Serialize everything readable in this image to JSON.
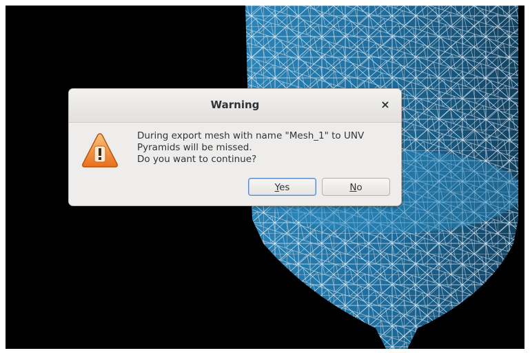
{
  "dialog": {
    "title": "Warning",
    "close_glyph": "×",
    "icon": "warning-triangle-icon",
    "message_lines": [
      "During export mesh with name \"Mesh_1\" to UNV",
      "Pyramids will be missed.",
      "Do you want to continue?"
    ],
    "buttons": {
      "yes_mnemonic": "Y",
      "yes_rest": "es",
      "no_mnemonic": "N",
      "no_rest": "o"
    }
  },
  "colors": {
    "mesh_fill": "#1f6a97",
    "mesh_lines": "#d6e6f2",
    "viewport_bg": "#000000",
    "warning_orange": "#f08a24"
  }
}
